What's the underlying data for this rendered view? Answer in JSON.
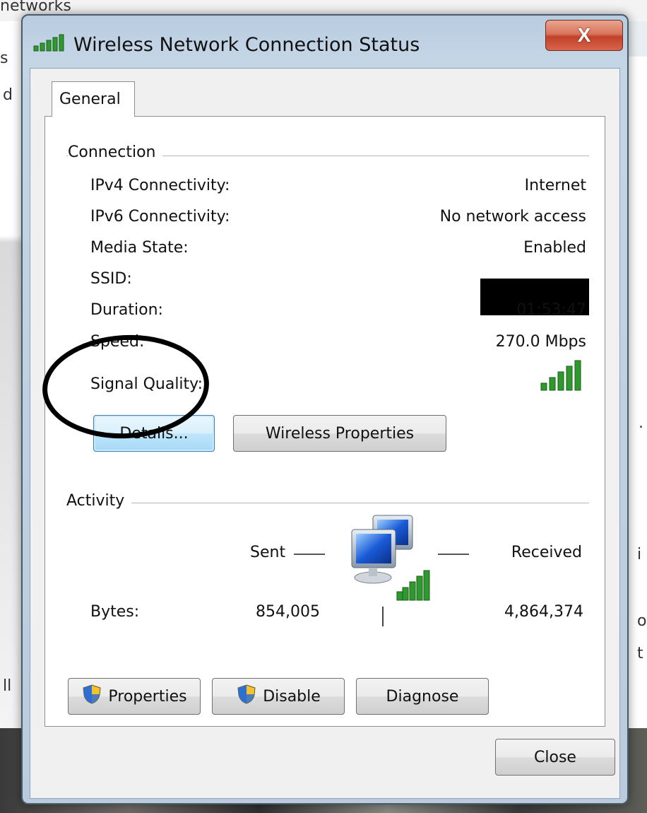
{
  "background": {
    "fragments": [
      "networks",
      "s",
      "d",
      "ll",
      "i",
      "o",
      "t",
      "."
    ]
  },
  "window": {
    "title": "Wireless Network Connection Status",
    "close_symbol": "X",
    "title_icon": "signal-bars-icon"
  },
  "tabs": [
    {
      "label": "General",
      "selected": true
    }
  ],
  "connection": {
    "group_label": "Connection",
    "rows": [
      {
        "label": "IPv4 Connectivity:",
        "value": "Internet"
      },
      {
        "label": "IPv6 Connectivity:",
        "value": "No network access"
      },
      {
        "label": "Media State:",
        "value": "Enabled"
      },
      {
        "label": "SSID:",
        "value": ""
      },
      {
        "label": "Duration:",
        "value": "01:53:47"
      },
      {
        "label": "Speed:",
        "value": "270.0 Mbps"
      },
      {
        "label": "Signal Quality:",
        "value": ""
      }
    ],
    "signal_bars": 5,
    "buttons": {
      "details": "Details...",
      "wireless_properties": "Wireless Properties"
    }
  },
  "activity": {
    "group_label": "Activity",
    "sent_label": "Sent",
    "received_label": "Received",
    "bytes_label": "Bytes:",
    "bytes_sent": "854,005",
    "bytes_received": "4,864,374"
  },
  "action_buttons": {
    "properties": "Properties",
    "disable": "Disable",
    "diagnose": "Diagnose"
  },
  "footer": {
    "close": "Close"
  },
  "colors": {
    "signal_green": "#2e9a2e",
    "accent_blue": "#3c7fb1",
    "close_red": "#c2412a"
  }
}
